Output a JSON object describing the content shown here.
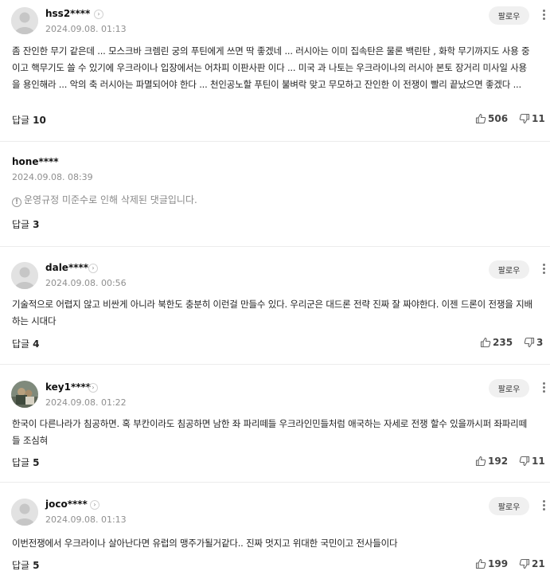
{
  "comments": [
    {
      "nick": "hss2****",
      "date": "2024.09.08. 01:13",
      "follow_label": "팔로우",
      "text": "좀 잔인한 무기 같은데 ... 모스크바 크렘린 궁의 푸틴에게 쓰면 딱 좋겠네 ... 러시아는 이미 집속탄은 물론 백린탄 , 화학 무기까지도 사용 중이고 핵무기도 쓸 수 있기에 우크라이나 입장에서는 어차피 이판사판 이다 ... 미국 과 나토는 우크라이나의 러시아 본토 장거리 미사일 사용을 용인해라 ... 악의 축 러시아는 파멸되어야 한다 ... 천인공노할 푸틴이 불벼락 맞고 무모하고 잔인한 이 전쟁이 빨리 끝났으면 좋겠다 ...",
      "reply_label": "답글",
      "reply_count": "10",
      "likes": "506",
      "dislikes": "11"
    },
    {
      "nick": "hone****",
      "date": "2024.09.08. 08:39",
      "deleted_text": "운영규정 미준수로 인해 삭제된 댓글입니다.",
      "reply_label": "답글",
      "reply_count": "3"
    },
    {
      "nick": "dale****",
      "date": "2024.09.08. 00:56",
      "follow_label": "팔로우",
      "text": "기술적으로 어렵지 않고 비싼게 아니라 북한도 충분히 이런걸 만들수 있다. 우리군은 대드론 전략 진짜 잘 짜야한다. 이젠 드론이 전쟁을 지배하는 시대다",
      "reply_label": "답글",
      "reply_count": "4",
      "likes": "235",
      "dislikes": "3"
    },
    {
      "nick": "key1****",
      "date": "2024.09.08. 01:22",
      "follow_label": "팔로우",
      "text": "한국이 다른나라가 침공하면. 혹 부칸이라도 침공하면 남한 좌 파리떼들 우크라인민들처럼 애국하는 자세로 전쟁 할수 있을까시퍼 좌파리떼들 조심혀",
      "reply_label": "답글",
      "reply_count": "5",
      "likes": "192",
      "dislikes": "11"
    },
    {
      "nick": "joco****",
      "date": "2024.09.08. 01:13",
      "follow_label": "팔로우",
      "text": "이번전쟁에서 우크라이나 살아난다면 유럽의 맹주가될거같다.. 진짜 멋지고 위대한 국민이고 전사들이다",
      "reply_label": "답글",
      "reply_count": "5",
      "likes": "199",
      "dislikes": "21"
    }
  ],
  "colors": {
    "text": "#222222",
    "meta": "#8f8f8f",
    "follow_bg": "#f0f0f0",
    "divider": "#ececec"
  },
  "icons": [
    "avatar-placeholder",
    "chevron-right-icon",
    "info-icon",
    "thumbs-up-icon",
    "thumbs-down-icon",
    "more-options-icon"
  ]
}
